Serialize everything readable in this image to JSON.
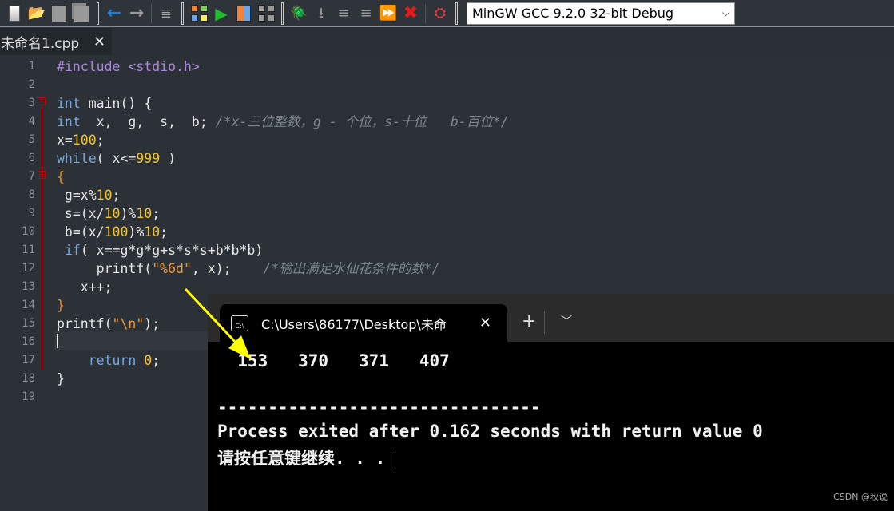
{
  "toolbar": {
    "icons": [
      "new-file-icon",
      "open-folder-icon",
      "save-icon",
      "save-all-icon",
      "back-arrow-icon",
      "forward-arrow-icon",
      "format-icon",
      "compile-icon",
      "run-icon",
      "compile-run-icon",
      "rebuild-icon",
      "debug-bug-icon",
      "step-icon",
      "step-into-icon",
      "step-out-icon",
      "continue-icon",
      "stop-icon",
      "profile-icon"
    ],
    "compiler": "MinGW GCC 9.2.0 32-bit Debug"
  },
  "tab": {
    "label": "未命名1.cpp",
    "close": "✕"
  },
  "editor": {
    "line_numbers": [
      "1",
      "2",
      "3",
      "4",
      "5",
      "6",
      "7",
      "8",
      "9",
      "10",
      "11",
      "12",
      "13",
      "14",
      "15",
      "16",
      "17",
      "18",
      "19"
    ],
    "lines": [
      [
        [
          "pp",
          "#include <stdio.h>"
        ]
      ],
      [],
      [
        [
          "kw",
          "int"
        ],
        [
          "tx",
          " main() {"
        ]
      ],
      [
        [
          "kw",
          "int"
        ],
        [
          "tx",
          "  x,  g,  s,  b; "
        ],
        [
          "cm",
          "/*x-三位整数，g - 个位，s-十位   b-百位*/"
        ]
      ],
      [
        [
          "tx",
          "x="
        ],
        [
          "num",
          "100"
        ],
        [
          "tx",
          ";"
        ]
      ],
      [
        [
          "kw",
          "while"
        ],
        [
          "tx",
          "( x<="
        ],
        [
          "num",
          "999"
        ],
        [
          "tx",
          " )"
        ]
      ],
      [
        [
          "br",
          "{"
        ]
      ],
      [
        [
          "tx",
          " g=x%"
        ],
        [
          "num",
          "10"
        ],
        [
          "tx",
          ";"
        ]
      ],
      [
        [
          "tx",
          " s=(x/"
        ],
        [
          "num",
          "10"
        ],
        [
          "tx",
          ")%"
        ],
        [
          "num",
          "10"
        ],
        [
          "tx",
          ";"
        ]
      ],
      [
        [
          "tx",
          " b=(x/"
        ],
        [
          "num",
          "100"
        ],
        [
          "tx",
          ")%"
        ],
        [
          "num",
          "10"
        ],
        [
          "tx",
          ";"
        ]
      ],
      [
        [
          "tx",
          " "
        ],
        [
          "kw",
          "if"
        ],
        [
          "tx",
          "( x==g*g*g+s*s*s+b*b*b)"
        ]
      ],
      [
        [
          "tx",
          "     printf("
        ],
        [
          "str",
          "\"%6d\""
        ],
        [
          "tx",
          ", x);    "
        ],
        [
          "cm",
          "/*输出满足水仙花条件的数*/"
        ]
      ],
      [
        [
          "tx",
          "   x++;"
        ]
      ],
      [
        [
          "br",
          "}"
        ]
      ],
      [
        [
          "tx",
          "printf("
        ],
        [
          "str",
          "\"\\n\""
        ],
        [
          "tx",
          ");"
        ]
      ],
      [],
      [
        [
          "tx",
          "    "
        ],
        [
          "kw",
          "return"
        ],
        [
          "tx",
          " "
        ],
        [
          "num",
          "0"
        ],
        [
          "tx",
          ";"
        ]
      ],
      [
        [
          "tx",
          "}"
        ]
      ],
      []
    ]
  },
  "terminal": {
    "tab_title": "C:\\Users\\86177\\Desktop\\未命",
    "close": "✕",
    "new_tab": "+",
    "dropdown": "⌄",
    "output": [
      "  153   370   371   407",
      "",
      "",
      "--------------------------------",
      "Process exited after 0.162 seconds with return value 0",
      "请按任意键继续. . ."
    ]
  },
  "watermark": "CSDN @秋说",
  "colors": {
    "keyword": "#7ba7d9",
    "preprocessor": "#a98ad8",
    "number": "#f2c52a",
    "string": "#ec9a3c",
    "comment": "#7d858c",
    "arrow": "#ffff00"
  }
}
